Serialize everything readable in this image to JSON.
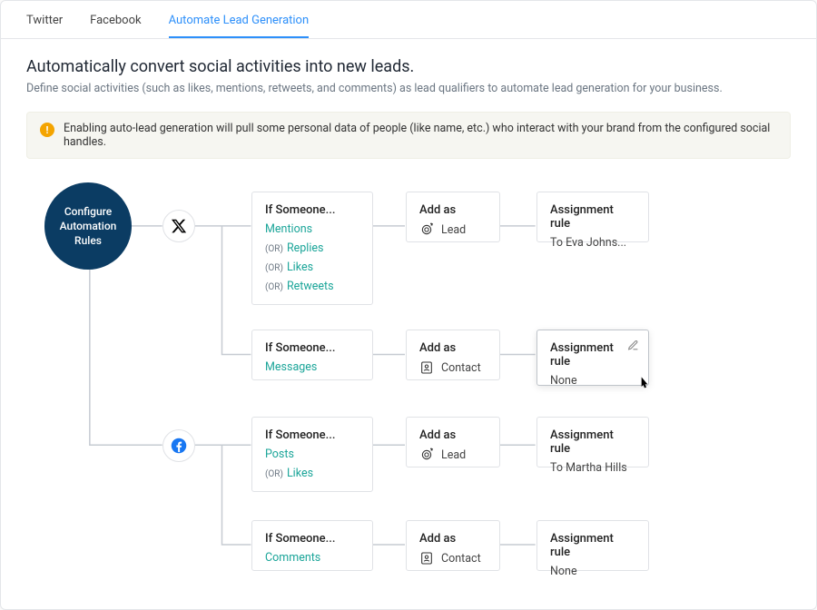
{
  "tabs": {
    "twitter": "Twitter",
    "facebook": "Facebook",
    "active": "Automate Lead Generation"
  },
  "header": {
    "title": "Automatically convert social activities into new leads.",
    "subtitle": "Define social activities (such as likes, mentions, retweets, and comments) as lead qualifiers to automate lead generation for your business."
  },
  "alert": {
    "text": "Enabling auto-lead generation will pull some personal data of people (like name, etc.) who interact with your brand from the configured social handles."
  },
  "diagram": {
    "root_label": "Configure Automation Rules",
    "if_label": "If Someone...",
    "or_label": "(OR)",
    "addas_label": "Add as",
    "assign_label": "Assignment rule",
    "twitter": {
      "rule1": {
        "triggers": [
          "Mentions",
          "Replies",
          "Likes",
          "Retweets"
        ],
        "addas": "Lead",
        "assign": "To Eva Johns..."
      },
      "rule2": {
        "triggers": [
          "Messages"
        ],
        "addas": "Contact",
        "assign": "None"
      }
    },
    "facebook": {
      "rule1": {
        "triggers": [
          "Posts",
          "Likes"
        ],
        "addas": "Lead",
        "assign": "To Martha Hills"
      },
      "rule2": {
        "triggers": [
          "Comments"
        ],
        "addas": "Contact",
        "assign": "None"
      }
    }
  }
}
